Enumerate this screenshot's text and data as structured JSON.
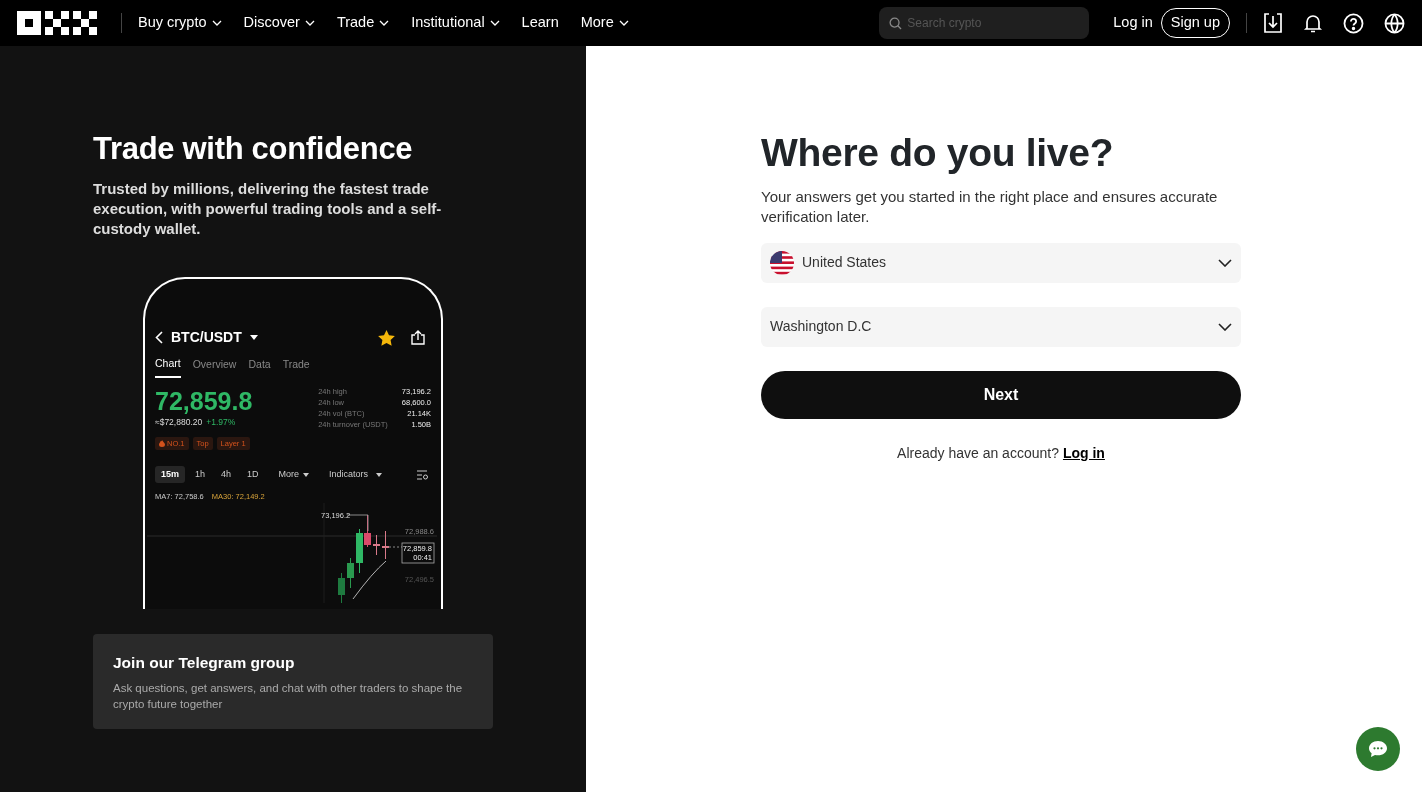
{
  "nav": {
    "items": [
      {
        "label": "Buy crypto",
        "has_menu": true
      },
      {
        "label": "Discover",
        "has_menu": true
      },
      {
        "label": "Trade",
        "has_menu": true
      },
      {
        "label": "Institutional",
        "has_menu": true
      },
      {
        "label": "Learn",
        "has_menu": false
      },
      {
        "label": "More",
        "has_menu": true
      }
    ],
    "search": {
      "placeholder": "Search crypto"
    },
    "login": "Log in",
    "signup": "Sign up"
  },
  "hero": {
    "title": "Trade with confidence",
    "subtitle": "Trusted by millions, delivering the fastest trade execution, with powerful trading tools and a self-custody wallet."
  },
  "phone": {
    "pair": "BTC/USDT",
    "favorite": true,
    "tabs": [
      {
        "label": "Chart",
        "selected": true
      },
      {
        "label": "Overview",
        "selected": false
      },
      {
        "label": "Data",
        "selected": false
      },
      {
        "label": "Trade",
        "selected": false
      }
    ],
    "price": "72,859.8",
    "fiat_price": "≈$72,880.20",
    "change": "+1.97%",
    "stats": [
      {
        "label": "24h high",
        "value": "73,196.2"
      },
      {
        "label": "24h low",
        "value": "68,600.0"
      },
      {
        "label": "24h vol (BTC)",
        "value": "21.14K"
      },
      {
        "label": "24h turnover (USDT)",
        "value": "1.50B"
      }
    ],
    "tags": [
      {
        "label": "NO.1",
        "hot": true
      },
      {
        "label": "Top",
        "hot": false
      },
      {
        "label": "Layer 1",
        "hot": false
      }
    ],
    "timeframes": [
      {
        "label": "15m",
        "selected": true
      },
      {
        "label": "1h",
        "selected": false
      },
      {
        "label": "4h",
        "selected": false
      },
      {
        "label": "1D",
        "selected": false
      }
    ],
    "more": "More",
    "indicators": "Indicators",
    "ma7": "MA7: 72,758.6",
    "ma30": "MA30: 72,149.2",
    "chart_labels": {
      "high": "73,196.2",
      "upper": "72,988.6",
      "last": "72,859.8",
      "countdown": "00:41",
      "lower": "72,496.5"
    }
  },
  "telegram": {
    "title": "Join our Telegram group",
    "text": "Ask questions, get answers, and chat with other traders to shape the crypto future together"
  },
  "form": {
    "title": "Where do you live?",
    "subtitle": "Your answers get you started in the right place and ensures accurate verification later.",
    "country": {
      "value": "United States"
    },
    "region": {
      "value": "Washington D.C"
    },
    "next": "Next",
    "prompt": "Already have an account?",
    "login_link": "Log in"
  }
}
